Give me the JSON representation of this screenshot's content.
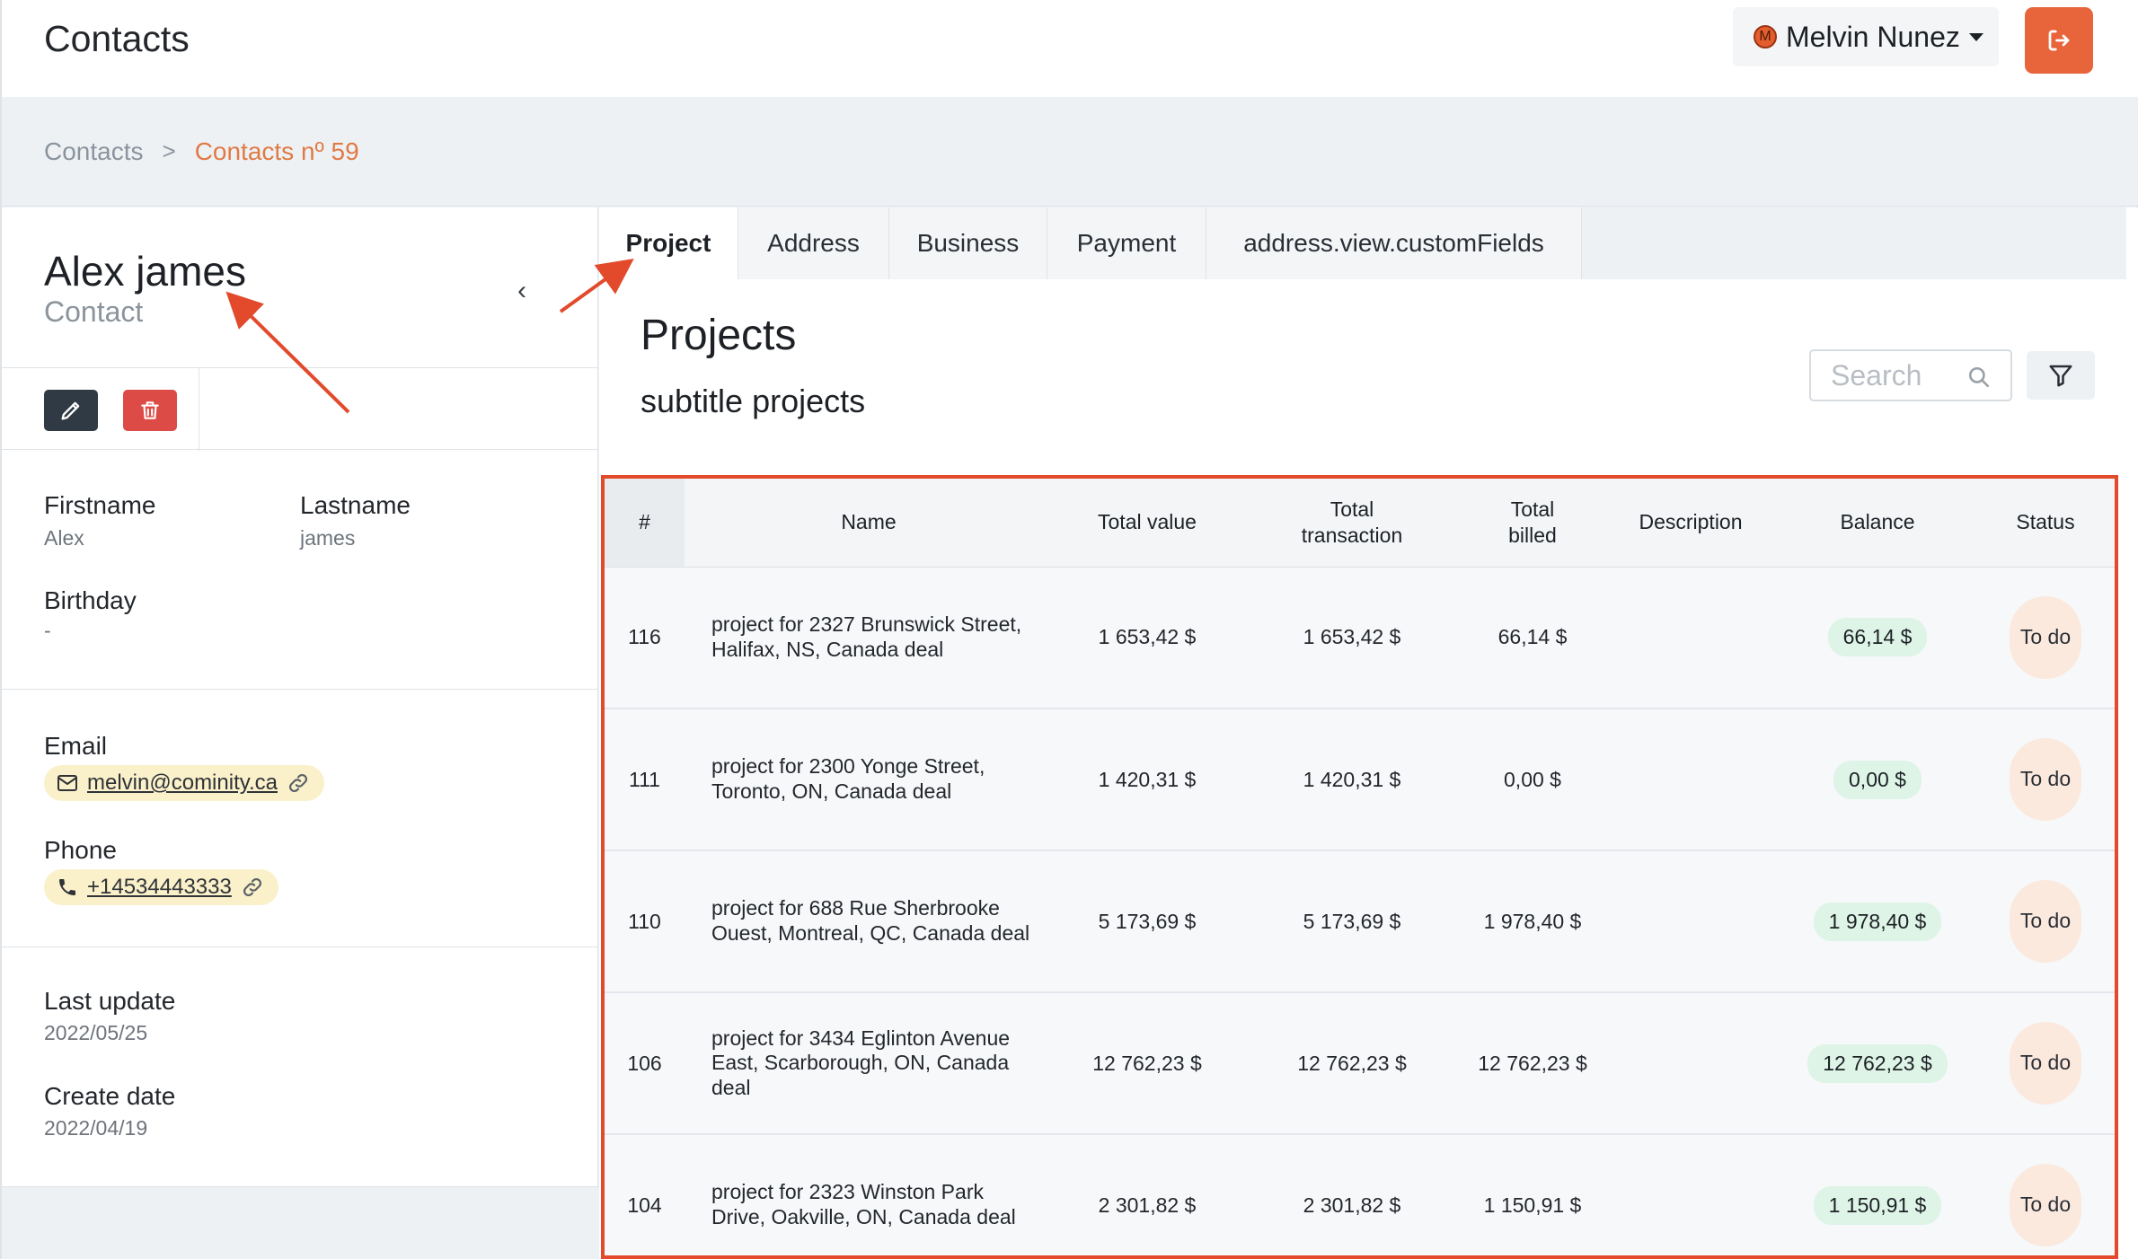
{
  "header": {
    "app_title": "Contacts",
    "user": {
      "initial": "M",
      "name": "Melvin Nunez"
    }
  },
  "breadcrumb": {
    "root": "Contacts",
    "separator": ">",
    "current": "Contacts nº 59"
  },
  "contact": {
    "name": "Alex james",
    "role": "Contact",
    "collapse_glyph": "‹",
    "fields": {
      "firstname_label": "Firstname",
      "firstname_value": "Alex",
      "lastname_label": "Lastname",
      "lastname_value": "james",
      "birthday_label": "Birthday",
      "birthday_value": "-",
      "email_label": "Email",
      "email_value": "melvin@cominity.ca",
      "phone_label": "Phone",
      "phone_value": "+14534443333",
      "last_update_label": "Last update",
      "last_update_value": "2022/05/25",
      "create_date_label": "Create date",
      "create_date_value": "2022/04/19"
    }
  },
  "tabs": [
    {
      "label": "Project",
      "active": true
    },
    {
      "label": "Address",
      "active": false
    },
    {
      "label": "Business",
      "active": false
    },
    {
      "label": "Payment",
      "active": false
    },
    {
      "label": "address.view.customFields",
      "active": false
    }
  ],
  "projects": {
    "title": "Projects",
    "subtitle": "subtitle projects",
    "search_placeholder": "Search",
    "columns": [
      "#",
      "Name",
      "Total value",
      "Total transaction",
      "Total billed",
      "Description",
      "Balance",
      "Status"
    ],
    "rows": [
      {
        "id": "116",
        "name": "project for 2327 Brunswick Street, Halifax, NS, Canada deal",
        "total_value": "1 653,42 $",
        "total_transaction": "1 653,42 $",
        "total_billed": "66,14 $",
        "description": "",
        "balance": "66,14 $",
        "status": "To do"
      },
      {
        "id": "111",
        "name": "project for 2300 Yonge Street, Toronto, ON, Canada deal",
        "total_value": "1 420,31 $",
        "total_transaction": "1 420,31 $",
        "total_billed": "0,00 $",
        "description": "",
        "balance": "0,00 $",
        "status": "To do"
      },
      {
        "id": "110",
        "name": "project for 688 Rue Sherbrooke Ouest, Montreal, QC, Canada deal",
        "total_value": "5 173,69 $",
        "total_transaction": "5 173,69 $",
        "total_billed": "1 978,40 $",
        "description": "",
        "balance": "1 978,40 $",
        "status": "To do"
      },
      {
        "id": "106",
        "name": "project for 3434 Eglinton Avenue East, Scarborough, ON, Canada deal",
        "total_value": "12 762,23 $",
        "total_transaction": "12 762,23 $",
        "total_billed": "12 762,23 $",
        "description": "",
        "balance": "12 762,23 $",
        "status": "To do"
      },
      {
        "id": "104",
        "name": "project for 2323 Winston Park Drive, Oakville, ON, Canada deal",
        "total_value": "2 301,82 $",
        "total_transaction": "2 301,82 $",
        "total_billed": "1 150,91 $",
        "description": "",
        "balance": "1 150,91 $",
        "status": "To do"
      }
    ]
  },
  "icons": {
    "logout": "logout-icon",
    "edit": "pencil-icon",
    "delete": "trash-icon",
    "email": "envelope-icon",
    "phone": "phone-icon",
    "link": "link-icon",
    "search": "search-icon",
    "filter": "filter-icon"
  },
  "colors": {
    "accent": "#e8643a",
    "breadcrumb_current": "#e07a45",
    "annotation": "#e24a2b",
    "balance_bg": "#ddf4e6",
    "status_bg": "#fbe9de",
    "chip_bg": "#faf0c9",
    "delete": "#dc4b45",
    "edit": "#2f3a44"
  }
}
